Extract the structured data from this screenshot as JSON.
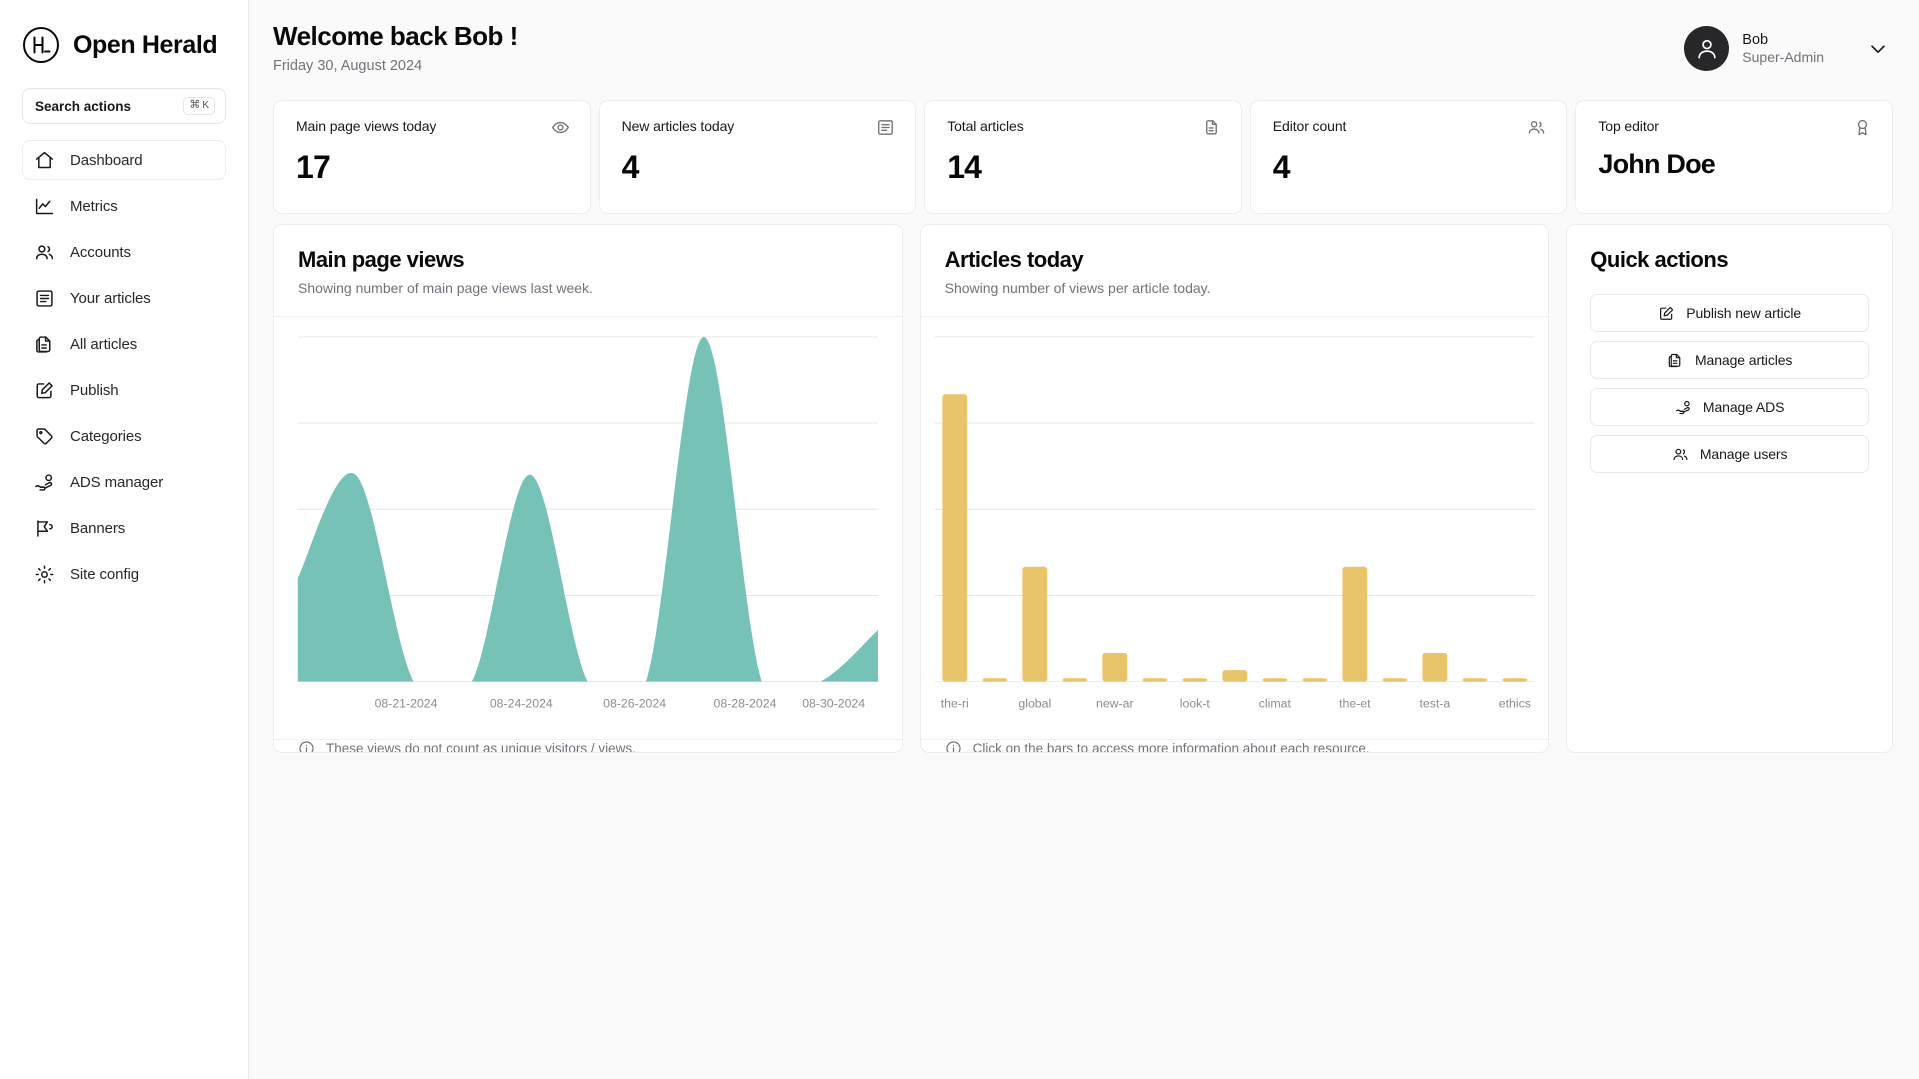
{
  "brand": {
    "name": "Open Herald",
    "logo_icon": "h-circle-logo-icon"
  },
  "search": {
    "label": "Search actions",
    "shortcut_mod": "⌘",
    "shortcut_key": "K"
  },
  "sidebar": {
    "items": [
      {
        "label": "Dashboard",
        "icon": "home-icon",
        "active": true
      },
      {
        "label": "Metrics",
        "icon": "line-chart-icon",
        "active": false
      },
      {
        "label": "Accounts",
        "icon": "users-icon",
        "active": false
      },
      {
        "label": "Your articles",
        "icon": "list-box-icon",
        "active": false
      },
      {
        "label": "All articles",
        "icon": "documents-icon",
        "active": false
      },
      {
        "label": "Publish",
        "icon": "edit-square-icon",
        "active": false
      },
      {
        "label": "Categories",
        "icon": "tag-icon",
        "active": false
      },
      {
        "label": "ADS manager",
        "icon": "hand-coin-icon",
        "active": false
      },
      {
        "label": "Banners",
        "icon": "megaphone-icon",
        "active": false
      },
      {
        "label": "Site config",
        "icon": "gear-icon",
        "active": false
      }
    ]
  },
  "header": {
    "welcome": "Welcome back Bob !",
    "date": "Friday 30, August 2024",
    "user": {
      "name": "Bob",
      "role": "Super-Admin",
      "avatar_icon": "person-icon",
      "chevron_icon": "chevron-down-icon"
    }
  },
  "stats": [
    {
      "label": "Main page views today",
      "value": "17",
      "icon": "eye-icon",
      "big": false
    },
    {
      "label": "New articles today",
      "value": "4",
      "icon": "list-box-icon",
      "big": false
    },
    {
      "label": "Total articles",
      "value": "14",
      "icon": "documents-icon",
      "big": false
    },
    {
      "label": "Editor count",
      "value": "4",
      "icon": "users-icon",
      "big": false
    },
    {
      "label": "Top editor",
      "value": "John Doe",
      "icon": "award-icon",
      "big": true
    }
  ],
  "panels": {
    "main_page_views": {
      "title": "Main page views",
      "subtitle": "Showing number of main page views last week.",
      "footnote": "These views do not count as unique visitors / views.",
      "footnote_icon": "info-icon"
    },
    "articles_today": {
      "title": "Articles today",
      "subtitle": "Showing number of views per article today.",
      "footnote": "Click on the bars to access more information about each resource.",
      "footnote_icon": "info-icon"
    }
  },
  "quick_actions": {
    "title": "Quick actions",
    "buttons": [
      {
        "label": "Publish new article",
        "icon": "edit-square-icon"
      },
      {
        "label": "Manage articles",
        "icon": "documents-icon"
      },
      {
        "label": "Manage ADS",
        "icon": "hand-coin-icon"
      },
      {
        "label": "Manage users",
        "icon": "users-icon"
      }
    ]
  },
  "colors": {
    "area_fill": "#76c2b6",
    "bar_fill": "#e8c46a",
    "grid": "#e6e6e9",
    "panel_border": "#ededf0",
    "page_bg": "#fafafa",
    "text_primary": "#09090b",
    "text_muted": "#71717a",
    "avatar_bg": "#27272a"
  },
  "chart_data": [
    {
      "type": "area",
      "title": "Main page views",
      "subtitle": "Showing number of main page views last week.",
      "xlabel": "",
      "ylabel": "",
      "grid": true,
      "legend": "none",
      "curve": "smooth",
      "fill_color": "#76c2b6",
      "tick_labels": [
        "08-21-2024",
        "08-24-2024",
        "08-26-2024",
        "08-28-2024",
        "08-30-2024"
      ],
      "x": [
        "08-20-2024",
        "08-21-2024",
        "08-22-2024",
        "08-23-2024",
        "08-24-2024",
        "08-25-2024",
        "08-26-2024",
        "08-27-2024",
        "08-28-2024",
        "08-29-2024",
        "08-30-2024"
      ],
      "values": [
        6,
        12,
        0,
        0,
        12,
        0,
        0,
        20,
        0,
        0,
        3
      ],
      "ylim": [
        0,
        20
      ],
      "gridline_count": 4
    },
    {
      "type": "bar",
      "title": "Articles today",
      "subtitle": "Showing number of views per article today.",
      "xlabel": "",
      "ylabel": "",
      "grid": true,
      "legend": "none",
      "bar_color": "#e8c46a",
      "categories": [
        "the-ri",
        "",
        "global",
        "",
        "new-ar",
        "",
        "look-t",
        "",
        "climat",
        "",
        "the-et",
        "",
        "test-a",
        "",
        "ethics"
      ],
      "tick_labels": [
        "the-ri",
        "global",
        "new-ar",
        "look-t",
        "climat",
        "the-et",
        "test-a",
        "ethics"
      ],
      "values": [
        10,
        0,
        4,
        0,
        1,
        0,
        0,
        0.4,
        0,
        0,
        4,
        0,
        1,
        0,
        0
      ],
      "ylim": [
        0,
        12
      ],
      "gridline_count": 4
    }
  ]
}
